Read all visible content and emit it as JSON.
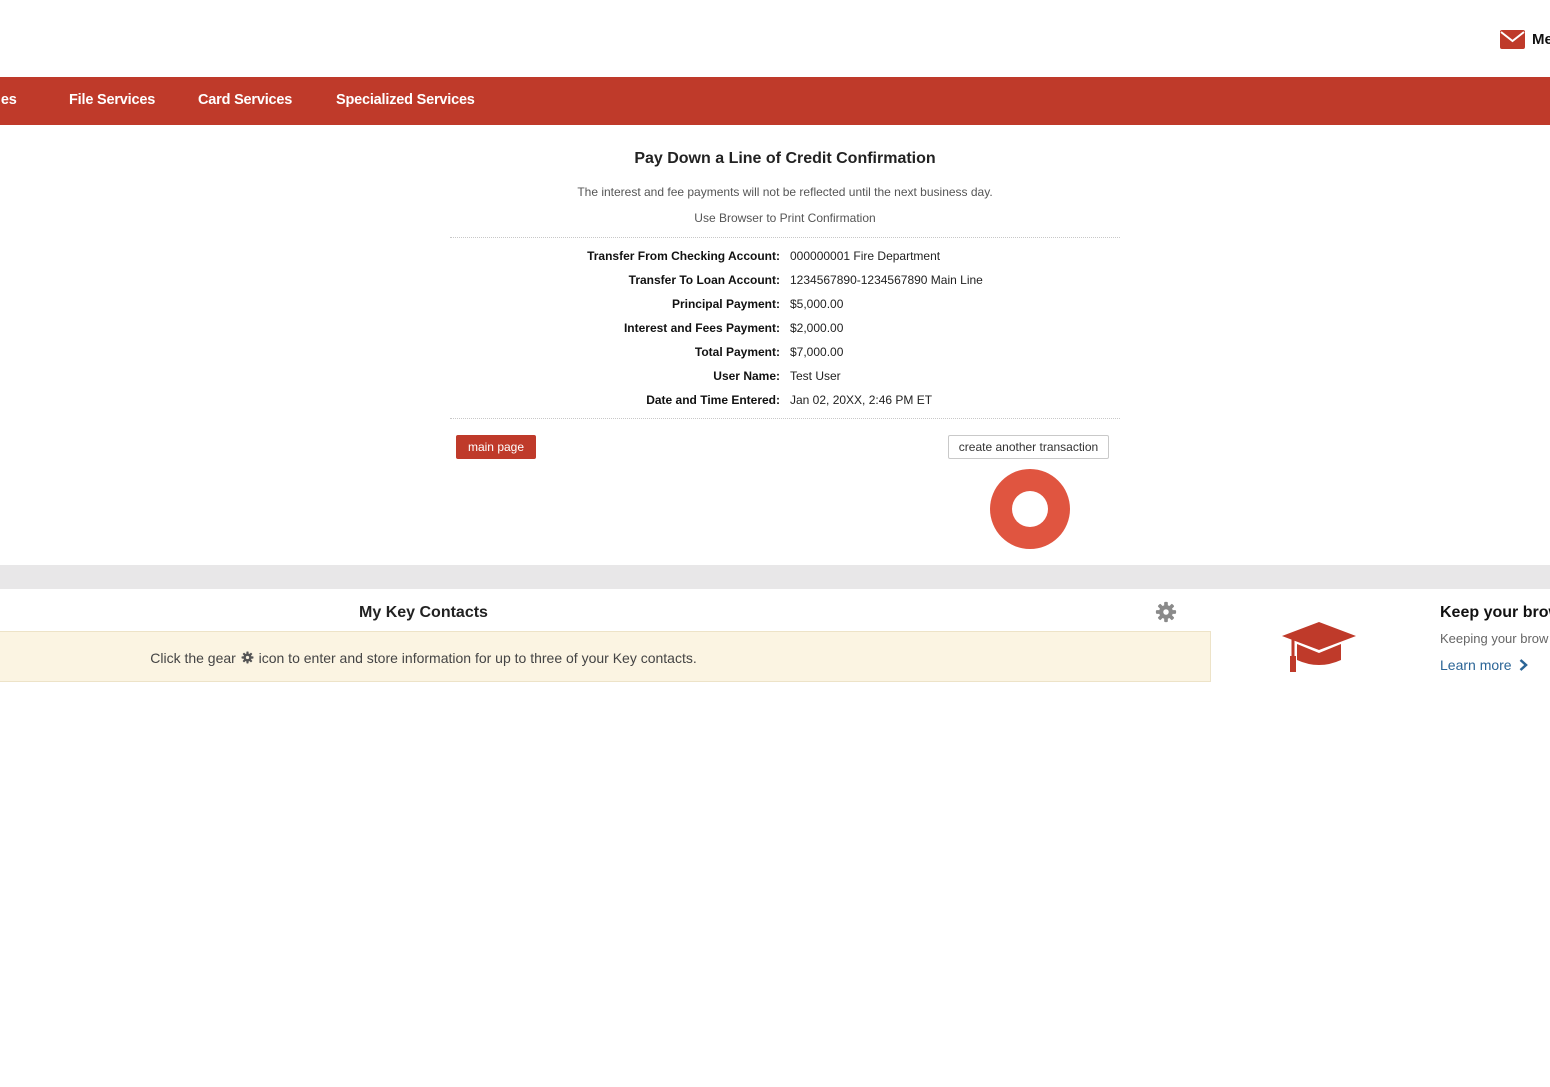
{
  "header": {
    "mail_label": "Me",
    "mail_icon": "envelope-icon"
  },
  "nav": {
    "items": [
      {
        "label": "les"
      },
      {
        "label": "File Services"
      },
      {
        "label": "Card Services"
      },
      {
        "label": "Specialized Services"
      }
    ],
    "background": "#bf3a2a"
  },
  "confirmation": {
    "title": "Pay Down a Line of Credit Confirmation",
    "notice": "The interest and fee payments will not be reflected until the next business day.",
    "print_hint": "Use Browser to Print Confirmation",
    "details": [
      {
        "label": "Transfer From Checking Account:",
        "value": "000000001 Fire Department"
      },
      {
        "label": "Transfer To Loan Account:",
        "value": "1234567890-1234567890 Main Line"
      },
      {
        "label": "Principal Payment:",
        "value": "$5,000.00"
      },
      {
        "label": "Interest and Fees Payment:",
        "value": "$2,000.00"
      },
      {
        "label": "Total Payment:",
        "value": "$7,000.00"
      },
      {
        "label": "User Name:",
        "value": "Test User"
      },
      {
        "label": "Date and Time Entered:",
        "value": "Jan 02, 20XX, 2:46 PM ET"
      }
    ],
    "main_page_label": "main page",
    "create_another_label": "create another transaction"
  },
  "key_contacts": {
    "title": "My Key Contacts",
    "message_before": "Click the gear",
    "message_after": "icon to enter and store information for up to three of your Key contacts.",
    "settings_icon": "gear-icon"
  },
  "side_promo": {
    "icon": "graduation-cap-icon",
    "title": "Keep your brow",
    "text": "Keeping your brow",
    "link_label": "Learn more"
  },
  "colors": {
    "brand_red": "#bf3a2a",
    "click_marker": "#e05540",
    "notice_bg": "#fbf4e2",
    "link_blue": "#2a6496"
  }
}
